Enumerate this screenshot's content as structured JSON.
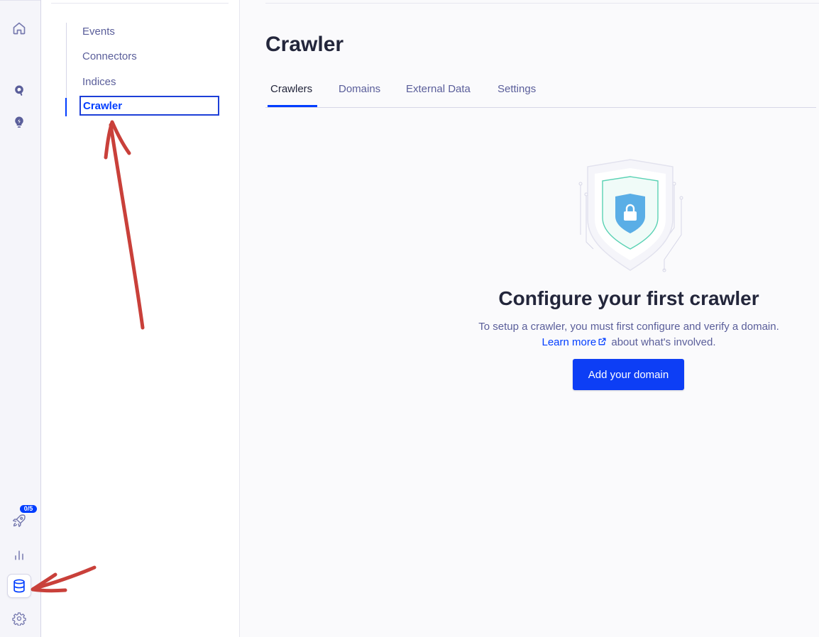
{
  "rail": {
    "onboarding_badge": "0/5",
    "icons": [
      "home-icon",
      "search-icon",
      "bolt-bulb-icon",
      "rocket-icon",
      "analytics-icon",
      "database-icon",
      "gear-icon"
    ],
    "active": "database-icon"
  },
  "subnav": {
    "items": [
      {
        "label": "Events"
      },
      {
        "label": "Connectors"
      },
      {
        "label": "Indices"
      },
      {
        "label": "Crawler"
      }
    ],
    "active_item": "Crawler"
  },
  "main": {
    "title": "Crawler",
    "tabs": [
      {
        "label": "Crawlers"
      },
      {
        "label": "Domains"
      },
      {
        "label": "External Data"
      },
      {
        "label": "Settings"
      }
    ],
    "active_tab": "Crawlers",
    "empty_state": {
      "title": "Configure your first crawler",
      "description_line1": "To setup a crawler, you must first configure and verify a domain.",
      "learn_more_label": "Learn more",
      "description_line2_rest": " about what's involved.",
      "cta_label": "Add your domain"
    }
  },
  "colors": {
    "accent": "#003dff",
    "text_primary": "#23263b",
    "text_secondary": "#5a5e9a",
    "annotation_arrow": "#c9403a"
  }
}
